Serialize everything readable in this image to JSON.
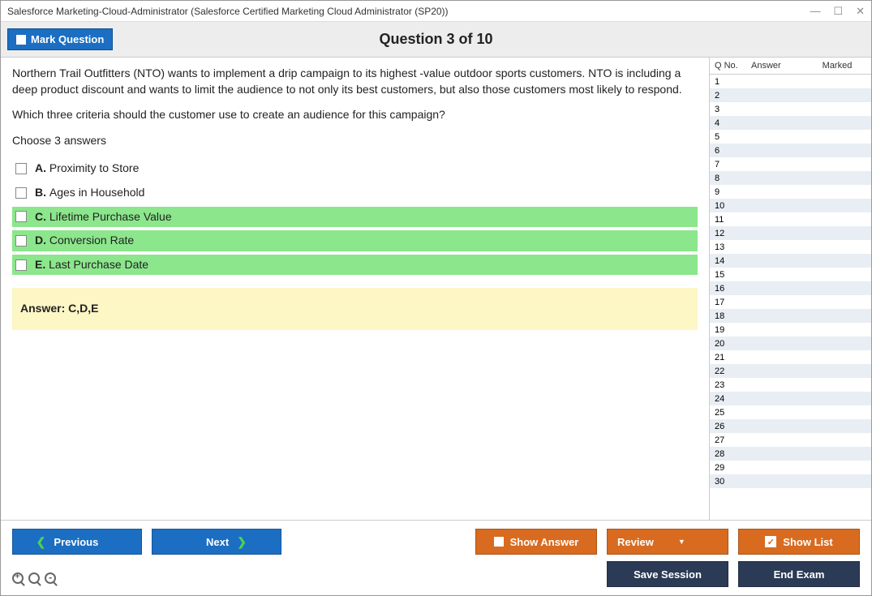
{
  "window": {
    "title": "Salesforce Marketing-Cloud-Administrator (Salesforce Certified Marketing Cloud Administrator (SP20))"
  },
  "header": {
    "mark_label": "Mark Question",
    "question_title": "Question 3 of 10"
  },
  "question": {
    "body": "Northern Trail Outfitters (NTO) wants to implement a drip campaign to its highest -value outdoor sports customers. NTO is including a deep product discount and wants to limit the audience to not only its best customers, but also those customers most likely to respond.",
    "prompt": "Which three criteria should the customer use to create an audience for this campaign?",
    "instruction": "Choose 3 answers",
    "options": [
      {
        "letter": "A.",
        "text": "Proximity to Store",
        "correct": false
      },
      {
        "letter": "B.",
        "text": "Ages in Household",
        "correct": false
      },
      {
        "letter": "C.",
        "text": "Lifetime Purchase Value",
        "correct": true
      },
      {
        "letter": "D.",
        "text": "Conversion Rate",
        "correct": true
      },
      {
        "letter": "E.",
        "text": "Last Purchase Date",
        "correct": true
      }
    ],
    "answer_label": "Answer: C,D,E"
  },
  "side": {
    "col_qno": "Q No.",
    "col_answer": "Answer",
    "col_marked": "Marked",
    "rows": [
      {
        "n": "1"
      },
      {
        "n": "2"
      },
      {
        "n": "3"
      },
      {
        "n": "4"
      },
      {
        "n": "5"
      },
      {
        "n": "6"
      },
      {
        "n": "7"
      },
      {
        "n": "8"
      },
      {
        "n": "9"
      },
      {
        "n": "10"
      },
      {
        "n": "11"
      },
      {
        "n": "12"
      },
      {
        "n": "13"
      },
      {
        "n": "14"
      },
      {
        "n": "15"
      },
      {
        "n": "16"
      },
      {
        "n": "17"
      },
      {
        "n": "18"
      },
      {
        "n": "19"
      },
      {
        "n": "20"
      },
      {
        "n": "21"
      },
      {
        "n": "22"
      },
      {
        "n": "23"
      },
      {
        "n": "24"
      },
      {
        "n": "25"
      },
      {
        "n": "26"
      },
      {
        "n": "27"
      },
      {
        "n": "28"
      },
      {
        "n": "29"
      },
      {
        "n": "30"
      }
    ]
  },
  "footer": {
    "previous": "Previous",
    "next": "Next",
    "show_answer": "Show Answer",
    "review": "Review",
    "show_list": "Show List",
    "save_session": "Save Session",
    "end_exam": "End Exam"
  }
}
